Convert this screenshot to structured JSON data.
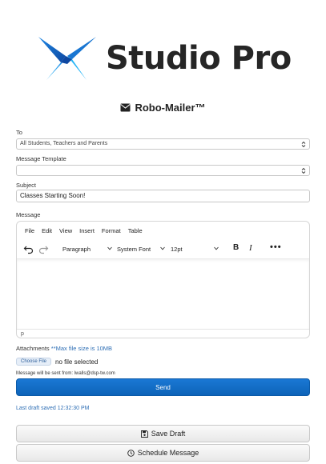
{
  "logo": {
    "text": "Studio Pro"
  },
  "app": {
    "title": "Robo-Mailer™"
  },
  "form": {
    "to_label": "To",
    "to_value": "All Students, Teachers and Parents",
    "template_label": "Message Template",
    "template_value": "",
    "subject_label": "Subject",
    "subject_value": "Classes Starting Soon!",
    "message_label": "Message"
  },
  "editor": {
    "menu": [
      "File",
      "Edit",
      "View",
      "Insert",
      "Format",
      "Table"
    ],
    "block_format": "Paragraph",
    "font_family": "System Font",
    "font_size": "12pt",
    "status_path": "p"
  },
  "attachments": {
    "label": "Attachments",
    "note": "**Max file size is 10MB",
    "choose_file_label": "Choose File",
    "file_status": "no file selected"
  },
  "sender_note": "Message will be sent from: lwalls@dsp-tw.com",
  "send_label": "Send",
  "draft_status": "Last draft saved 12:32:30 PM",
  "save_draft_label": "Save Draft",
  "schedule_label": "Schedule Message",
  "colors": {
    "primary": "#0d6efd",
    "logo_blue_dark": "#1565c0",
    "logo_blue_light": "#29b6f6",
    "link": "#2f6fb5"
  }
}
